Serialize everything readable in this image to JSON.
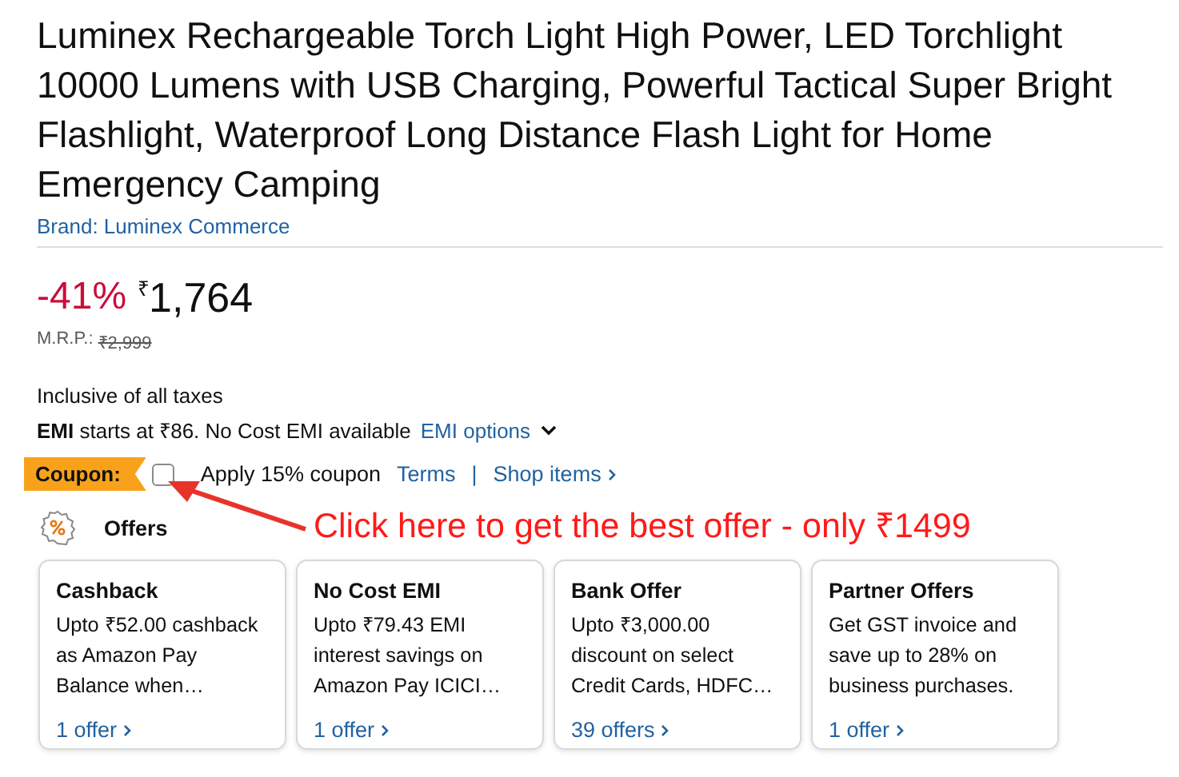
{
  "title": "Luminex Rechargeable Torch Light High Power, LED Torchlight 10000 Lumens with USB Charging, Powerful Tactical Super Bright Flashlight, Waterproof Long Distance Flash Light for Home Emergency Camping",
  "brand": "Brand: Luminex Commerce",
  "price": {
    "discount": "-41%",
    "currency": "₹",
    "amount": "1,764",
    "mrp_label": "M.R.P.:",
    "mrp": "₹2,999"
  },
  "tax_note": "Inclusive of all taxes",
  "emi": {
    "text": "**EMI** starts at ₹86. No Cost EMI available",
    "link": "EMI options"
  },
  "coupon": {
    "badge": "Coupon:",
    "checked": false,
    "label": "Apply 15% coupon",
    "terms": "Terms",
    "separator": "|",
    "shop": "Shop items"
  },
  "offers": {
    "heading": "Offers",
    "cards": [
      {
        "title": "Cashback",
        "body": "Upto ₹52.00 cashback as Amazon Pay Balance when…",
        "link": "1 offer"
      },
      {
        "title": "No Cost EMI",
        "body": "Upto ₹79.43 EMI interest savings on Amazon Pay ICICI…",
        "link": "1 offer"
      },
      {
        "title": "Bank Offer",
        "body": "Upto ₹3,000.00 discount on select Credit Cards, HDFC…",
        "link": "39 offers"
      },
      {
        "title": "Partner Offers",
        "body": "Get GST invoice and save up to 28% on business purchases.",
        "link": "1 offer"
      }
    ]
  },
  "annotation": "Click here to get the best offer - only ₹1499"
}
